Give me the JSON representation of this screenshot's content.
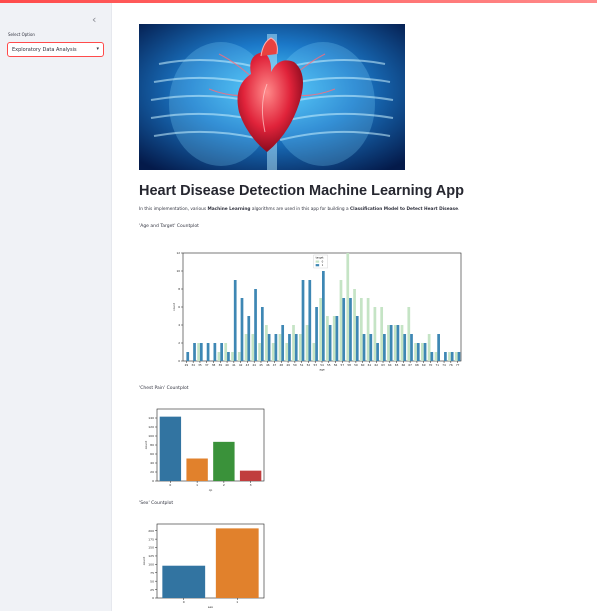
{
  "sidebar": {
    "collapse_icon": "chevron-left-icon",
    "select_label": "Select Option",
    "select_value": "Exploratory Data Analysis",
    "caret_icon": "chevron-down-icon"
  },
  "main": {
    "hero_image": "heart-lungs-illustration",
    "title": "Heart Disease Detection Machine Learning App",
    "intro": {
      "prefix": "In this implementation, various ",
      "bold1": "Machine Learning",
      "middle": " algorithms are used in this app for building a ",
      "bold2": "Classification Model to Detect Heart Disease",
      "suffix": "."
    },
    "captions": {
      "age": "'Age and Target' Countplot",
      "chest_pain": "'Chest Pain' Countplot",
      "sex": "'Sex' Countplot"
    }
  },
  "chart_data": [
    {
      "type": "bar",
      "xlabel": "age",
      "ylabel": "count",
      "ylim": [
        0,
        12
      ],
      "yticks": [
        0,
        2,
        4,
        6,
        8,
        10,
        12
      ],
      "legend": {
        "title": "target",
        "placement": "top-center",
        "entries": [
          "0",
          "1"
        ]
      },
      "colors": {
        "0": "#c5e4c5",
        "1": "#3e87b4"
      },
      "categories": [
        "29",
        "34",
        "35",
        "37",
        "38",
        "39",
        "40",
        "41",
        "42",
        "43",
        "44",
        "45",
        "46",
        "47",
        "48",
        "49",
        "50",
        "51",
        "52",
        "53",
        "54",
        "55",
        "56",
        "57",
        "58",
        "59",
        "60",
        "61",
        "62",
        "63",
        "64",
        "65",
        "66",
        "67",
        "68",
        "69",
        "70",
        "71",
        "74",
        "76",
        "77"
      ],
      "series": [
        {
          "name": "0",
          "values": [
            0,
            0,
            2,
            0,
            0,
            1,
            2,
            1,
            1,
            3,
            3,
            2,
            4,
            2,
            3,
            2,
            4,
            3,
            4,
            2,
            7,
            5,
            5,
            9,
            12,
            8,
            7,
            7,
            6,
            6,
            4,
            4,
            4,
            6,
            2,
            2,
            3,
            1,
            0,
            1,
            1
          ]
        },
        {
          "name": "1",
          "values": [
            1,
            2,
            2,
            2,
            2,
            2,
            1,
            9,
            7,
            5,
            8,
            6,
            3,
            3,
            4,
            3,
            3,
            9,
            9,
            6,
            10,
            4,
            5,
            7,
            7,
            5,
            3,
            3,
            2,
            3,
            4,
            4,
            3,
            3,
            2,
            2,
            1,
            3,
            1,
            1,
            1
          ]
        }
      ]
    },
    {
      "type": "bar",
      "xlabel": "cp",
      "ylabel": "count",
      "ylim": [
        0,
        160
      ],
      "yticks": [
        0,
        20,
        40,
        60,
        80,
        100,
        120,
        140
      ],
      "categories": [
        "0",
        "1",
        "2",
        "3"
      ],
      "values": [
        143,
        50,
        87,
        23
      ],
      "colors": [
        "#3274a1",
        "#e1812c",
        "#3a923a",
        "#c03d3e"
      ]
    },
    {
      "type": "bar",
      "xlabel": "sex",
      "ylabel": "count",
      "ylim": [
        0,
        220
      ],
      "yticks": [
        0,
        25,
        50,
        75,
        100,
        125,
        150,
        175,
        200
      ],
      "categories": [
        "0",
        "1"
      ],
      "values": [
        96,
        207
      ],
      "colors": [
        "#3274a1",
        "#e1812c"
      ]
    }
  ]
}
